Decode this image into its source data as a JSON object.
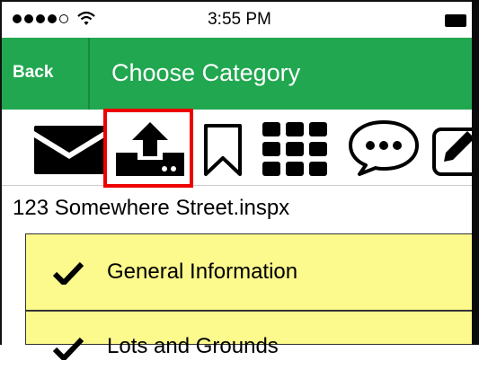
{
  "status_bar": {
    "time": "3:55 PM",
    "signal_icon": "signal-dots-icon",
    "wifi_icon": "wifi-icon",
    "battery_icon": "battery-icon"
  },
  "nav": {
    "back_label": "Back",
    "title": "Choose Category",
    "accent_color": "#21a750"
  },
  "toolbar": {
    "icons": [
      "envelope-icon",
      "upload-icon",
      "bookmark-icon",
      "grid-icon",
      "chat-bubble-icon",
      "edit-icon"
    ],
    "highlighted": "upload-icon",
    "highlight_color": "#e00000"
  },
  "document": {
    "filename": "123 Somewhere Street.inspx"
  },
  "categories": [
    {
      "label": "General Information",
      "checked": true
    },
    {
      "label": "Lots and Grounds",
      "checked": true
    }
  ],
  "list_background": "#fcf98d"
}
